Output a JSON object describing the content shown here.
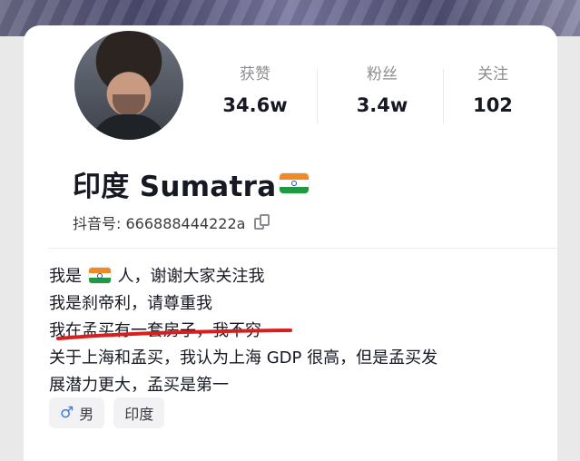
{
  "profile": {
    "stats": [
      {
        "label": "获赞",
        "value": "34.6w"
      },
      {
        "label": "粉丝",
        "value": "3.4w"
      },
      {
        "label": "关注",
        "value": "102"
      }
    ],
    "name": "印度 Sumatra",
    "flag_icon": "india-flag-icon",
    "id_label": "抖音号: 666888444222a",
    "bio": {
      "line1_prefix": "我是",
      "line1_suffix": "人，谢谢大家关注我",
      "line2": "我是刹帝利，请尊重我",
      "line3": "我在孟买有一套房子，我不穷",
      "line4": "关于上海和孟买，我认为上海 GDP 很高，但是孟买发",
      "line5": "展潜力更大，孟买是第一"
    },
    "tags": {
      "gender_icon": "male-icon",
      "gender": "男",
      "location": "印度"
    }
  },
  "colors": {
    "accent_red": "#d81f1f",
    "tag_bg": "#f2f2f4",
    "muted": "#8d8d93"
  }
}
